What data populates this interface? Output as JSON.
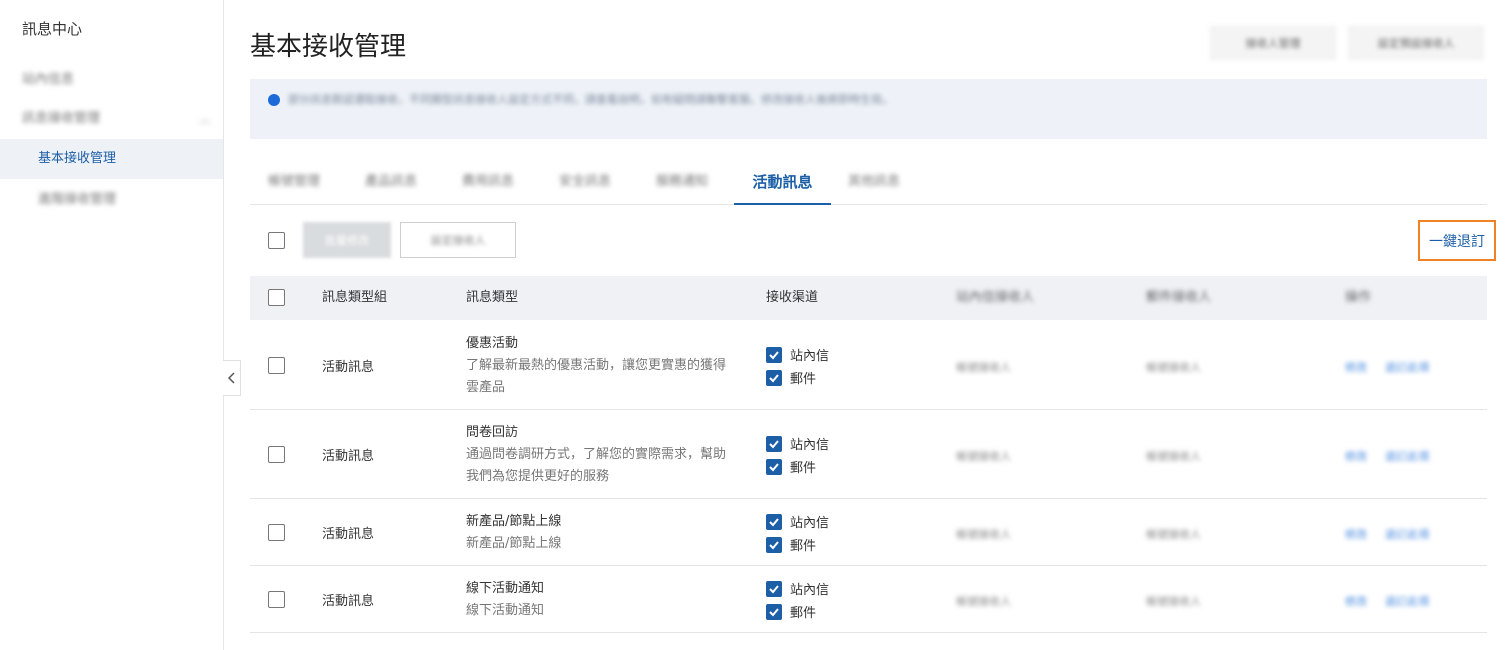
{
  "sidebar": {
    "title": "訊息中心",
    "items": [
      {
        "label": "站內信息",
        "blurred": true
      },
      {
        "label": "訊息接收管理",
        "blurred": true
      },
      {
        "label": "基本接收管理",
        "blurred": false
      },
      {
        "label": "進階接收管理",
        "blurred": true
      }
    ]
  },
  "header": {
    "title": "基本接收管理",
    "buttons": [
      "接收人管理",
      "設定預設接收人"
    ]
  },
  "notice": {
    "text": "部分訊息默認選取接收，不同類型訊息接收人設定方式不同，請查看說明，如有疑問請聯繫客服。修改接收人後將即時生效。"
  },
  "tabs": [
    {
      "label": "帳號管理",
      "active": false
    },
    {
      "label": "產品訊息",
      "active": false
    },
    {
      "label": "費用訊息",
      "active": false
    },
    {
      "label": "安全訊息",
      "active": false
    },
    {
      "label": "服務通知",
      "active": false
    },
    {
      "label": "活動訊息",
      "active": true
    },
    {
      "label": "其他訊息",
      "active": false
    }
  ],
  "toolbar": {
    "btn_primary": "批量修改",
    "btn_secondary": "設定接收人",
    "unsubscribe_all": "一鍵退訂"
  },
  "table": {
    "headers": {
      "group": "訊息類型組",
      "type": "訊息類型",
      "channel": "接收渠道",
      "col4": "站內信接收人",
      "col5": "郵件接收人",
      "col6": "操作"
    },
    "rows": [
      {
        "group": "活動訊息",
        "name": "優惠活動",
        "desc": "了解最新最熱的優惠活動，讓您更實惠的獲得雲產品",
        "ch1": "站內信",
        "ch2": "郵件",
        "r1": "帳號接收人",
        "r2": "帳號接收人",
        "op1": "修改",
        "op2": "退訂此項"
      },
      {
        "group": "活動訊息",
        "name": "問卷回訪",
        "desc": "通過問卷調研方式，了解您的實際需求，幫助我們為您提供更好的服務",
        "ch1": "站內信",
        "ch2": "郵件",
        "r1": "帳號接收人",
        "r2": "帳號接收人",
        "op1": "修改",
        "op2": "退訂此項"
      },
      {
        "group": "活動訊息",
        "name": "新產品/節點上線",
        "desc": "新產品/節點上線",
        "ch1": "站內信",
        "ch2": "郵件",
        "r1": "帳號接收人",
        "r2": "帳號接收人",
        "op1": "修改",
        "op2": "退訂此項"
      },
      {
        "group": "活動訊息",
        "name": "線下活動通知",
        "desc": "線下活動通知",
        "ch1": "站內信",
        "ch2": "郵件",
        "r1": "帳號接收人",
        "r2": "帳號接收人",
        "op1": "修改",
        "op2": "退訂此項"
      }
    ]
  },
  "colors": {
    "accent": "#1c5fa6",
    "highlight": "#f08224",
    "notice_bg": "#eef2f8"
  }
}
